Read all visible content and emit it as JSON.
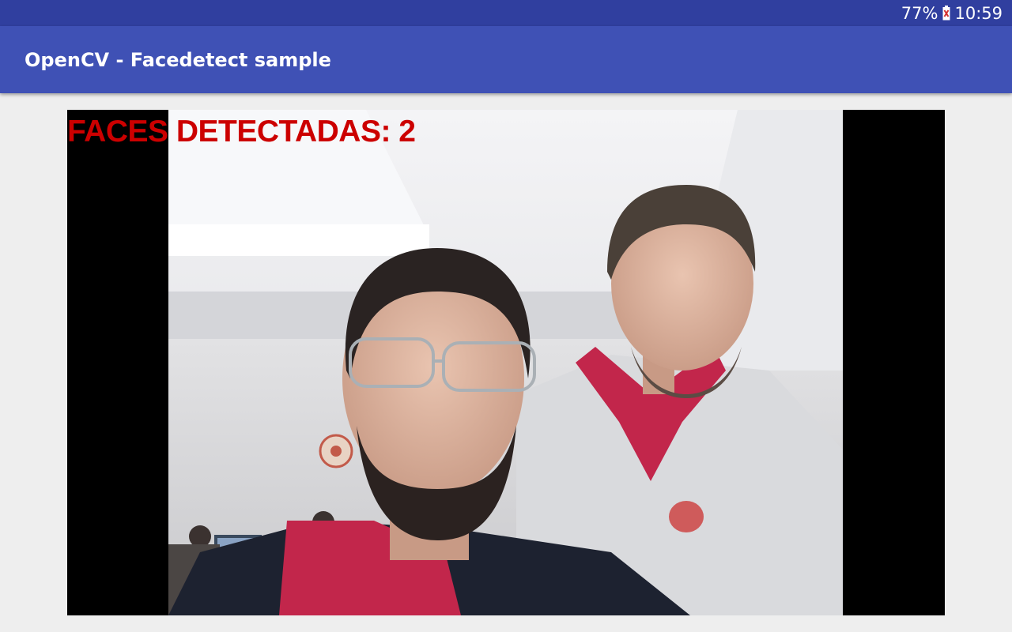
{
  "status_bar": {
    "battery_percent": "77%",
    "time": "10:59",
    "battery_icon": "battery-alert-icon"
  },
  "app_bar": {
    "title": "OpenCV - Facedetect sample"
  },
  "camera": {
    "overlay_text": "FACES DETECTADAS: 2",
    "overlay_color": "#cc0000",
    "faces_detected": 2
  },
  "colors": {
    "status_bar": "#303f9f",
    "app_bar": "#3f51b5",
    "background": "#eeeeee"
  }
}
